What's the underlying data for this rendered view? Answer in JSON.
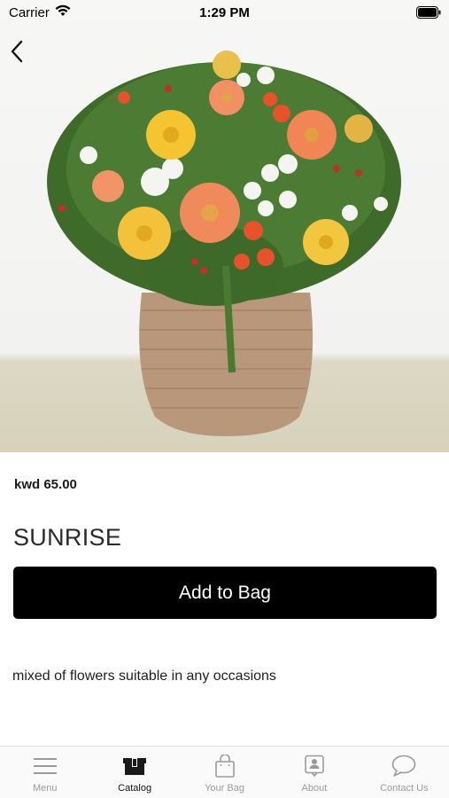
{
  "status_bar": {
    "carrier": "Carrier",
    "time": "1:29 PM"
  },
  "product": {
    "price": "kwd 65.00",
    "name": "SUNRISE",
    "add_to_bag_label": "Add to Bag",
    "description": "mixed of flowers suitable in any occasions"
  },
  "tabs": [
    {
      "label": "Menu",
      "icon": "menu-icon",
      "active": false
    },
    {
      "label": "Catalog",
      "icon": "catalog-icon",
      "active": true
    },
    {
      "label": "Your Bag",
      "icon": "bag-icon",
      "active": false
    },
    {
      "label": "About",
      "icon": "about-icon",
      "active": false
    },
    {
      "label": "Contact Us",
      "icon": "chat-icon",
      "active": false
    }
  ],
  "colors": {
    "accent": "#000000",
    "tab_inactive": "#9a9a9a",
    "tab_active": "#111111"
  }
}
